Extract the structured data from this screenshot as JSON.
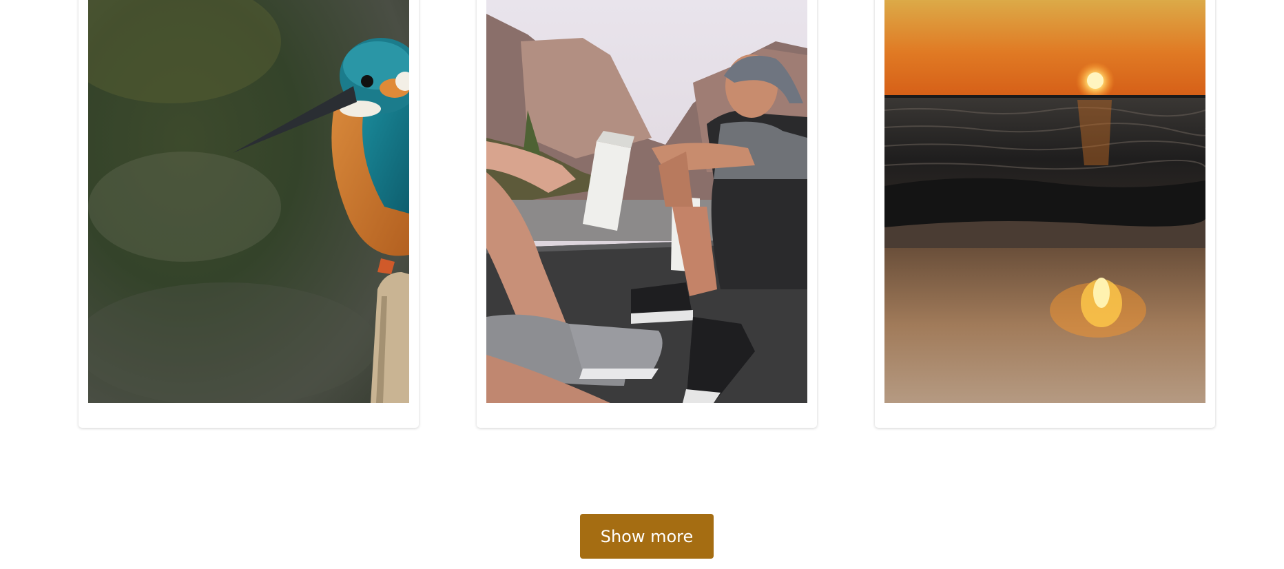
{
  "gallery": {
    "cards": [
      {
        "name": "photo-card-kingfisher",
        "image": "kingfisher-on-branch-photo"
      },
      {
        "name": "photo-card-friends",
        "image": "friends-sitting-on-car-photo"
      },
      {
        "name": "photo-card-sunset",
        "image": "sunset-over-sea-photo"
      }
    ]
  },
  "show_more": {
    "label": "Show more",
    "background": "#a56d12"
  },
  "colors": {
    "page_background": "#ffffff",
    "card_background": "#ffffff",
    "accent": "#a56d12"
  }
}
